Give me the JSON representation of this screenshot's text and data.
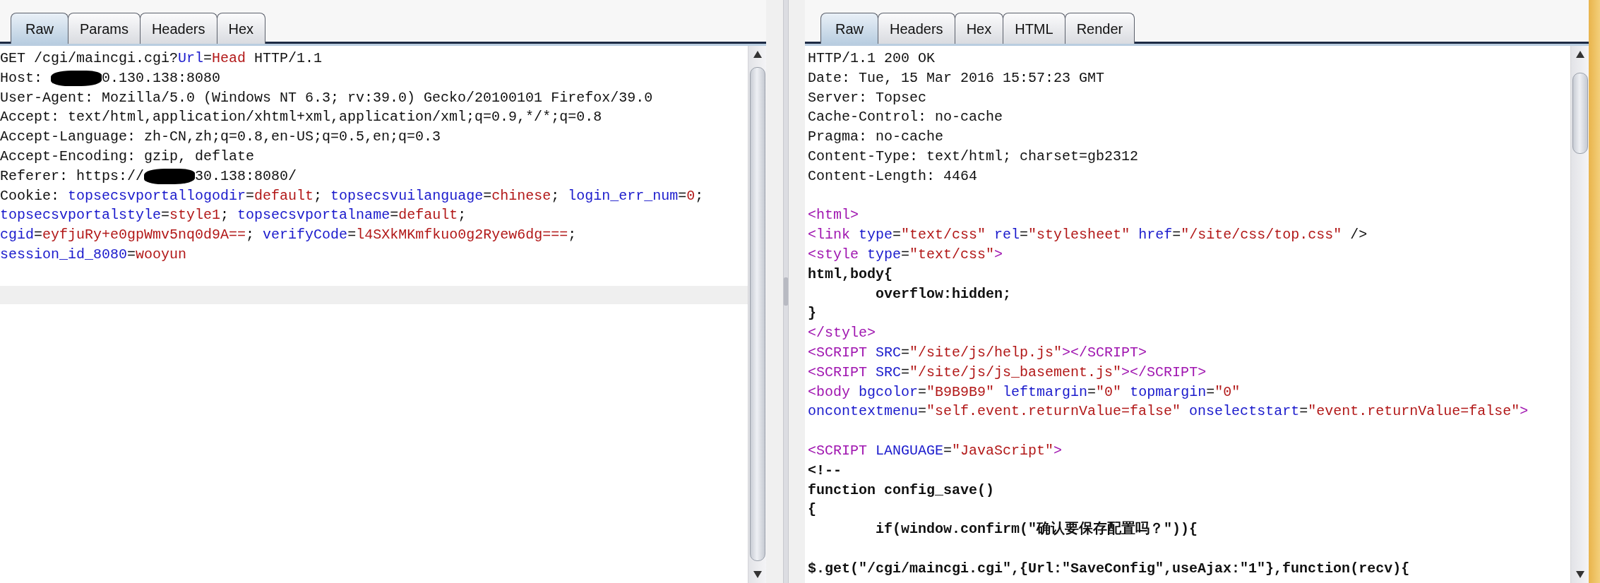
{
  "request": {
    "tabs": [
      {
        "label": "Raw",
        "selected": true
      },
      {
        "label": "Params",
        "selected": false
      },
      {
        "label": "Headers",
        "selected": false
      },
      {
        "label": "Hex",
        "selected": false
      }
    ],
    "lines": [
      [
        {
          "kind": "plain",
          "text": "GET /cgi/maincgi.cgi?"
        },
        {
          "kind": "name",
          "text": "Url"
        },
        {
          "kind": "plain",
          "text": "="
        },
        {
          "kind": "value",
          "text": "Head"
        },
        {
          "kind": "plain",
          "text": " HTTP/1.1"
        }
      ],
      [
        {
          "kind": "plain",
          "text": "Host: "
        },
        {
          "kind": "redaction"
        },
        {
          "kind": "plain",
          "text": "0.130.138:8080"
        }
      ],
      [
        {
          "kind": "plain",
          "text": "User-Agent: Mozilla/5.0 (Windows NT 6.3; rv:39.0) Gecko/20100101 Firefox/39.0"
        }
      ],
      [
        {
          "kind": "plain",
          "text": "Accept: text/html,application/xhtml+xml,application/xml;q=0.9,*/*;q=0.8"
        }
      ],
      [
        {
          "kind": "plain",
          "text": "Accept-Language: zh-CN,zh;q=0.8,en-US;q=0.5,en;q=0.3"
        }
      ],
      [
        {
          "kind": "plain",
          "text": "Accept-Encoding: gzip, deflate"
        }
      ],
      [
        {
          "kind": "plain",
          "text": "Referer: https://"
        },
        {
          "kind": "redaction"
        },
        {
          "kind": "plain",
          "text": "30.138:8080/"
        }
      ],
      [
        {
          "kind": "plain",
          "text": "Cookie: "
        },
        {
          "kind": "name",
          "text": "topsecsvportallogodir"
        },
        {
          "kind": "plain",
          "text": "="
        },
        {
          "kind": "value",
          "text": "default"
        },
        {
          "kind": "plain",
          "text": "; "
        },
        {
          "kind": "name",
          "text": "topsecsvuilanguage"
        },
        {
          "kind": "plain",
          "text": "="
        },
        {
          "kind": "value",
          "text": "chinese"
        },
        {
          "kind": "plain",
          "text": "; "
        },
        {
          "kind": "name",
          "text": "login_err_num"
        },
        {
          "kind": "plain",
          "text": "="
        },
        {
          "kind": "value",
          "text": "0"
        },
        {
          "kind": "plain",
          "text": ";"
        }
      ],
      [
        {
          "kind": "name",
          "text": "topsecsvportalstyle"
        },
        {
          "kind": "plain",
          "text": "="
        },
        {
          "kind": "value",
          "text": "style1"
        },
        {
          "kind": "plain",
          "text": "; "
        },
        {
          "kind": "name",
          "text": "topsecsvportalname"
        },
        {
          "kind": "plain",
          "text": "="
        },
        {
          "kind": "value",
          "text": "default"
        },
        {
          "kind": "plain",
          "text": ";"
        }
      ],
      [
        {
          "kind": "name",
          "text": "cgid"
        },
        {
          "kind": "plain",
          "text": "="
        },
        {
          "kind": "value",
          "text": "eyfjuRy+e0gpWmv5nq0d9A=="
        },
        {
          "kind": "plain",
          "text": "; "
        },
        {
          "kind": "name",
          "text": "verifyCode"
        },
        {
          "kind": "plain",
          "text": "="
        },
        {
          "kind": "value",
          "text": "l4SXkMKmfkuo0g2Ryew6dg==="
        },
        {
          "kind": "plain",
          "text": ";"
        }
      ],
      [
        {
          "kind": "name",
          "text": "session_id_8080"
        },
        {
          "kind": "plain",
          "text": "="
        },
        {
          "kind": "value",
          "text": "wooyun"
        }
      ]
    ]
  },
  "response": {
    "tabs": [
      {
        "label": "Raw",
        "selected": true
      },
      {
        "label": "Headers",
        "selected": false
      },
      {
        "label": "Hex",
        "selected": false
      },
      {
        "label": "HTML",
        "selected": false
      },
      {
        "label": "Render",
        "selected": false
      }
    ],
    "lines": [
      [
        {
          "kind": "plain",
          "text": "HTTP/1.1 200 OK"
        }
      ],
      [
        {
          "kind": "plain",
          "text": "Date: Tue, 15 Mar 2016 15:57:23 GMT"
        }
      ],
      [
        {
          "kind": "plain",
          "text": "Server: Topsec"
        }
      ],
      [
        {
          "kind": "plain",
          "text": "Cache-Control: no-cache"
        }
      ],
      [
        {
          "kind": "plain",
          "text": "Pragma: no-cache"
        }
      ],
      [
        {
          "kind": "plain",
          "text": "Content-Type: text/html; charset=gb2312"
        }
      ],
      [
        {
          "kind": "plain",
          "text": "Content-Length: 4464"
        }
      ],
      [
        {
          "kind": "blank"
        }
      ],
      [
        {
          "kind": "tag",
          "text": "<html>"
        }
      ],
      [
        {
          "kind": "tag",
          "text": "<link"
        },
        {
          "kind": "name",
          "text": " type"
        },
        {
          "kind": "plain",
          "text": "="
        },
        {
          "kind": "value",
          "text": "\"text/css\""
        },
        {
          "kind": "name",
          "text": " rel"
        },
        {
          "kind": "plain",
          "text": "="
        },
        {
          "kind": "value",
          "text": "\"stylesheet\""
        },
        {
          "kind": "name",
          "text": " href"
        },
        {
          "kind": "plain",
          "text": "="
        },
        {
          "kind": "value",
          "text": "\"/site/css/top.css\""
        },
        {
          "kind": "plain",
          "text": " />"
        }
      ],
      [
        {
          "kind": "tag",
          "text": "<style"
        },
        {
          "kind": "name",
          "text": " type"
        },
        {
          "kind": "plain",
          "text": "="
        },
        {
          "kind": "value",
          "text": "\"text/css\""
        },
        {
          "kind": "tag",
          "text": ">"
        }
      ],
      [
        {
          "kind": "bold",
          "text": "html,body{"
        }
      ],
      [
        {
          "kind": "bold",
          "text": "        overflow:hidden;"
        }
      ],
      [
        {
          "kind": "bold",
          "text": "}"
        }
      ],
      [
        {
          "kind": "tag",
          "text": "</style>"
        }
      ],
      [
        {
          "kind": "tag",
          "text": "<SCRIPT"
        },
        {
          "kind": "name",
          "text": " SRC"
        },
        {
          "kind": "plain",
          "text": "="
        },
        {
          "kind": "value",
          "text": "\"/site/js/help.js\""
        },
        {
          "kind": "tag",
          "text": "></SCRIPT>"
        }
      ],
      [
        {
          "kind": "tag",
          "text": "<SCRIPT"
        },
        {
          "kind": "name",
          "text": " SRC"
        },
        {
          "kind": "plain",
          "text": "="
        },
        {
          "kind": "value",
          "text": "\"/site/js/js_basement.js\""
        },
        {
          "kind": "tag",
          "text": "></SCRIPT>"
        }
      ],
      [
        {
          "kind": "tag",
          "text": "<body"
        },
        {
          "kind": "name",
          "text": " bgcolor"
        },
        {
          "kind": "plain",
          "text": "="
        },
        {
          "kind": "value",
          "text": "\"B9B9B9\""
        },
        {
          "kind": "name",
          "text": " leftmargin"
        },
        {
          "kind": "plain",
          "text": "="
        },
        {
          "kind": "value",
          "text": "\"0\""
        },
        {
          "kind": "name",
          "text": " topmargin"
        },
        {
          "kind": "plain",
          "text": "="
        },
        {
          "kind": "value",
          "text": "\"0\""
        }
      ],
      [
        {
          "kind": "name",
          "text": "oncontextmenu"
        },
        {
          "kind": "plain",
          "text": "="
        },
        {
          "kind": "value",
          "text": "\"self.event.returnValue=false\""
        },
        {
          "kind": "name",
          "text": " onselectstart"
        },
        {
          "kind": "plain",
          "text": "="
        },
        {
          "kind": "value",
          "text": "\"event.returnValue=false\""
        },
        {
          "kind": "tag",
          "text": ">"
        }
      ],
      [
        {
          "kind": "blank"
        }
      ],
      [
        {
          "kind": "tag",
          "text": "<SCRIPT"
        },
        {
          "kind": "name",
          "text": " LANGUAGE"
        },
        {
          "kind": "plain",
          "text": "="
        },
        {
          "kind": "value",
          "text": "\"JavaScript\""
        },
        {
          "kind": "tag",
          "text": ">"
        }
      ],
      [
        {
          "kind": "bold",
          "text": "<!--"
        }
      ],
      [
        {
          "kind": "bold",
          "text": "function config_save()"
        }
      ],
      [
        {
          "kind": "bold",
          "text": "{"
        }
      ],
      [
        {
          "kind": "bold",
          "text": "        if(window.confirm(\"确认要保存配置吗？\")){"
        }
      ],
      [
        {
          "kind": "blank"
        }
      ],
      [
        {
          "kind": "bold",
          "text": "$.get(\"/cgi/maincgi.cgi\",{Url:\"SaveConfig\",useAjax:\"1\"},function(recv){"
        }
      ]
    ]
  }
}
